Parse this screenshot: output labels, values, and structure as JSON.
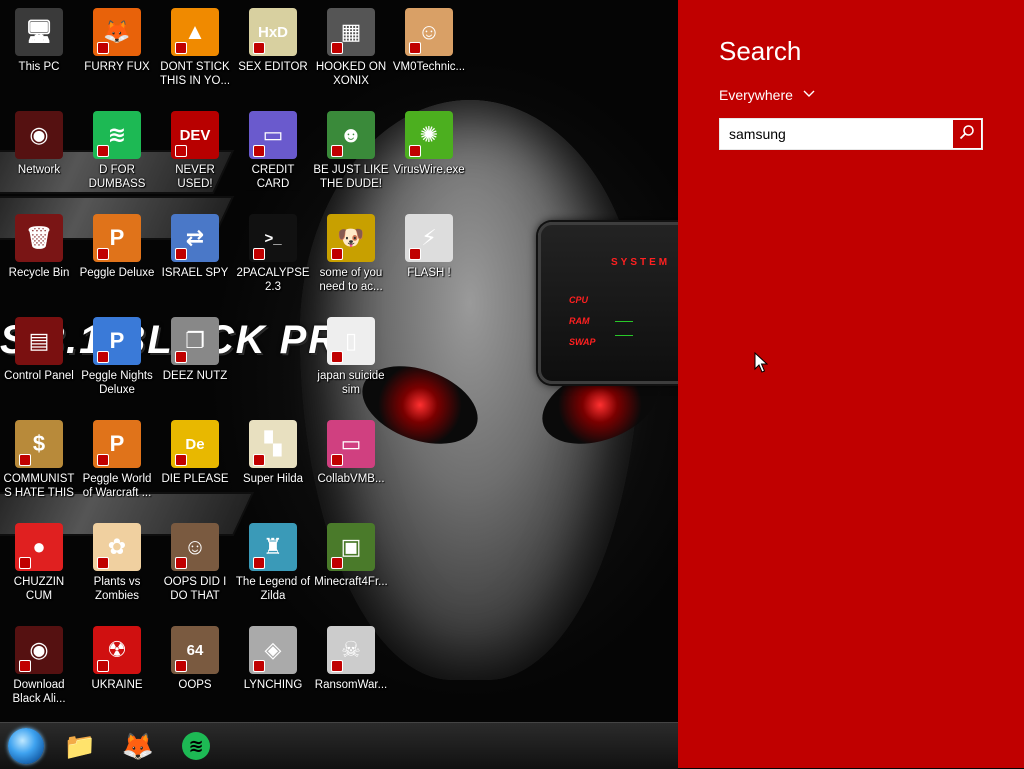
{
  "desktop": {
    "wallpaper_text": "S 8.1 BLACK PRO",
    "widget": {
      "brand": "SYSTEM",
      "cpu": "CPU",
      "ram": "RAM",
      "swap": "SWAP"
    },
    "icons": [
      {
        "label": "This PC",
        "icon": "computer-icon",
        "color": "#3a3a3a",
        "glyph": "🖥"
      },
      {
        "label": "FURRY FUX",
        "icon": "firefox-icon",
        "color": "#e8620a",
        "glyph": "🦊"
      },
      {
        "label": "DONT STICK THIS IN YO...",
        "icon": "vlc-cone-icon",
        "color": "#f08a00",
        "glyph": "▲"
      },
      {
        "label": "SEX EDITOR",
        "icon": "hxd-editor-icon",
        "color": "#d8d0a0",
        "glyph": "HxD"
      },
      {
        "label": "HOOKED ON XONIX",
        "icon": "xonix-game-icon",
        "color": "#555555",
        "glyph": "▦"
      },
      {
        "label": "VM0Technic...",
        "icon": "doctor-avatar-icon",
        "color": "#d9a066",
        "glyph": "☺"
      },
      {
        "label": "Network",
        "icon": "alien-network-icon",
        "color": "#551111",
        "glyph": "◉"
      },
      {
        "label": "D FOR DUMBASS",
        "icon": "spotify-icon",
        "color": "#1db954",
        "glyph": "≋"
      },
      {
        "label": "NEVER USED!",
        "icon": "dev-cpp-icon",
        "color": "#b80000",
        "glyph": "DEV"
      },
      {
        "label": "CREDIT CARD CHECKER",
        "icon": "credit-card-icon",
        "color": "#6a5acd",
        "glyph": "▭"
      },
      {
        "label": "BE JUST LIKE THE DUDE!",
        "icon": "elf-character-icon",
        "color": "#3a8a3a",
        "glyph": "☻"
      },
      {
        "label": "VirusWire.exe",
        "icon": "lime-wire-icon",
        "color": "#4caf1f",
        "glyph": "✺"
      },
      {
        "label": "Recycle Bin",
        "icon": "recycle-bin-icon",
        "color": "#7a1515",
        "glyph": "🗑"
      },
      {
        "label": "Peggle Deluxe",
        "icon": "peggle-icon",
        "color": "#e0731a",
        "glyph": "P"
      },
      {
        "label": "ISRAEL SPY",
        "icon": "network-share-icon",
        "color": "#4a78c8",
        "glyph": "⇄"
      },
      {
        "label": "2PACALYPSE 2.3",
        "icon": "command-prompt-icon",
        "color": "#111111",
        "glyph": ">_"
      },
      {
        "label": "some of you need to ac...",
        "icon": "cartoon-dog-icon",
        "color": "#c8a000",
        "glyph": "🐶"
      },
      {
        "label": "FLASH !",
        "icon": "flash-file-icon",
        "color": "#dddddd",
        "glyph": "⚡"
      },
      {
        "label": "Control Panel",
        "icon": "control-panel-icon",
        "color": "#7a1010",
        "glyph": "▤"
      },
      {
        "label": "Peggle Nights Deluxe",
        "icon": "peggle-nights-icon",
        "color": "#3a7ad8",
        "glyph": "P"
      },
      {
        "label": "DEEZ NUTZ",
        "icon": "stacked-windows-icon",
        "color": "#888888",
        "glyph": "❐"
      },
      {
        "label": "japan suicide sim",
        "icon": "game-file-icon",
        "color": "#eeeeee",
        "glyph": "▯"
      },
      {
        "label": "COMMUNISTS HATE THIS G...",
        "icon": "money-bag-icon",
        "color": "#b88a3a",
        "glyph": "$"
      },
      {
        "label": "Peggle World of Warcraft ...",
        "icon": "peggle-wow-icon",
        "color": "#e0731a",
        "glyph": "P"
      },
      {
        "label": "DIE PLEASE",
        "icon": "dlang-icon",
        "color": "#e8b800",
        "glyph": "De"
      },
      {
        "label": "Super Hilda",
        "icon": "pixel-character-icon",
        "color": "#e8e0c0",
        "glyph": "▚"
      },
      {
        "label": "CollabVMB...",
        "icon": "collabvm-icon",
        "color": "#d04080",
        "glyph": "▭"
      },
      {
        "label": "CHUZZIN CUM",
        "icon": "chuzzle-icon",
        "color": "#e02020",
        "glyph": "●"
      },
      {
        "label": "Plants vs Zombies",
        "icon": "plants-vs-zombies-icon",
        "color": "#f0d0a0",
        "glyph": "✿"
      },
      {
        "label": "OOPS DID I DO THAT",
        "icon": "portrait-painting-icon",
        "color": "#7a5a40",
        "glyph": "☺"
      },
      {
        "label": "The Legend of Zilda",
        "icon": "pixel-hero-icon",
        "color": "#3a9ab8",
        "glyph": "♜"
      },
      {
        "label": "Minecraft4Fr...",
        "icon": "minecraft-block-icon",
        "color": "#4a7a2a",
        "glyph": "▣"
      },
      {
        "label": "Download Black Ali...",
        "icon": "alien-download-icon",
        "color": "#551111",
        "glyph": "◉"
      },
      {
        "label": "UKRAINE",
        "icon": "radiation-icon",
        "color": "#d01010",
        "glyph": "☢"
      },
      {
        "label": "OOPS",
        "icon": "portrait-64-icon",
        "color": "#7a5a40",
        "glyph": "64"
      },
      {
        "label": "LYNCHING",
        "icon": "tor-onion-icon",
        "color": "#aaaaaa",
        "glyph": "◈"
      },
      {
        "label": "RansomWar...",
        "icon": "skull-icon",
        "color": "#cccccc",
        "glyph": "☠"
      }
    ]
  },
  "taskbar": {
    "items": [
      {
        "name": "start-button",
        "icon": "start-orb-icon"
      },
      {
        "name": "file-explorer-button",
        "icon": "folder-icon",
        "glyph": "📁",
        "color": "#e8c040"
      },
      {
        "name": "firefox-button",
        "icon": "firefox-icon",
        "glyph": "🦊",
        "color": "#e8620a"
      },
      {
        "name": "spotify-button",
        "icon": "spotify-icon",
        "glyph": "≋",
        "color": "#1db954"
      }
    ]
  },
  "search": {
    "title": "Search",
    "scope": "Everywhere",
    "query": "samsung",
    "accent": "#c00000"
  }
}
